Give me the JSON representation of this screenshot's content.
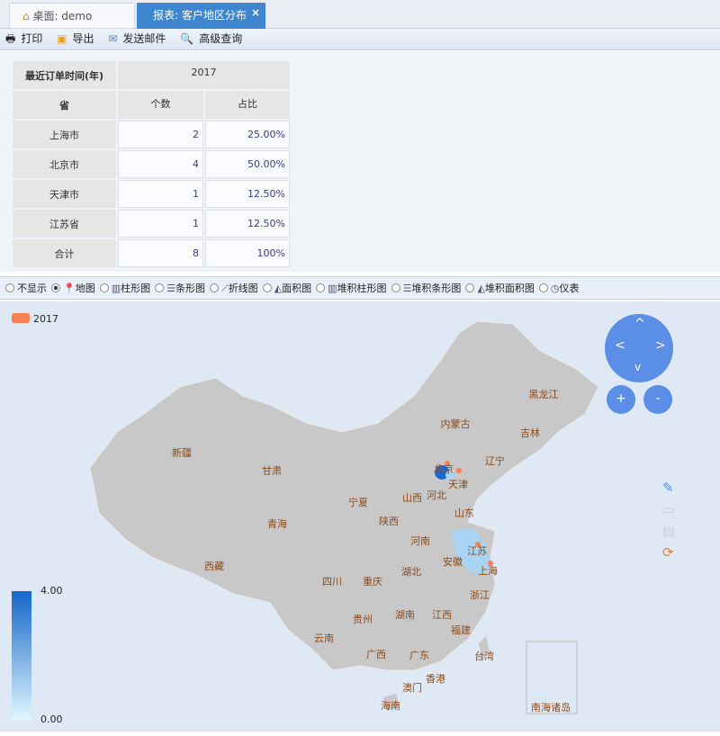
{
  "tabs": [
    {
      "label": "桌面: demo",
      "icon": "home-icon"
    },
    {
      "label": "报表: 客户地区分布",
      "close": "×"
    }
  ],
  "toolbar": [
    {
      "label": "打印",
      "icon": "printer-icon"
    },
    {
      "label": "导出",
      "icon": "export-icon"
    },
    {
      "label": "发送邮件",
      "icon": "mail-icon"
    },
    {
      "label": "高级查询",
      "icon": "search-icon"
    }
  ],
  "table": {
    "corner_top": "最近订单时间(年)",
    "corner_bottom": "省",
    "year": "2017",
    "col_count": "个数",
    "col_ratio": "占比",
    "rows": [
      {
        "name": "上海市",
        "count": "2",
        "ratio": "25.00%"
      },
      {
        "name": "北京市",
        "count": "4",
        "ratio": "50.00%"
      },
      {
        "name": "天津市",
        "count": "1",
        "ratio": "12.50%"
      },
      {
        "name": "江苏省",
        "count": "1",
        "ratio": "12.50%"
      },
      {
        "name": "合计",
        "count": "8",
        "ratio": "100%"
      }
    ]
  },
  "chart_types": {
    "selected": "地图",
    "options": [
      "不显示",
      "地图",
      "柱形图",
      "条形图",
      "折线图",
      "面积图",
      "堆积柱形图",
      "堆积条形图",
      "堆积面积图",
      "仪表"
    ]
  },
  "map": {
    "legend": "2017",
    "legend_color": "#ff7f50",
    "nav": {
      "up": "^",
      "down": "v",
      "left": "<",
      "right": ">"
    },
    "zoom_in": "+",
    "zoom_out": "-",
    "visual_map": {
      "max": "4.00",
      "min": "0.00"
    },
    "provinces": [
      "黑龙江",
      "吉林",
      "辽宁",
      "内蒙古",
      "新疆",
      "甘肃",
      "北京",
      "天津",
      "宁夏",
      "山西",
      "河北",
      "山东",
      "青海",
      "陕西",
      "河南",
      "江苏",
      "安徽",
      "上海",
      "西藏",
      "四川",
      "重庆",
      "湖北",
      "浙江",
      "贵州",
      "湖南",
      "江西",
      "福建",
      "云南",
      "广西",
      "广东",
      "台湾",
      "香港",
      "澳门",
      "海南",
      "南海诸岛"
    ],
    "values": {
      "北京": 4,
      "上海": 2,
      "天津": 1,
      "江苏": 1
    }
  }
}
